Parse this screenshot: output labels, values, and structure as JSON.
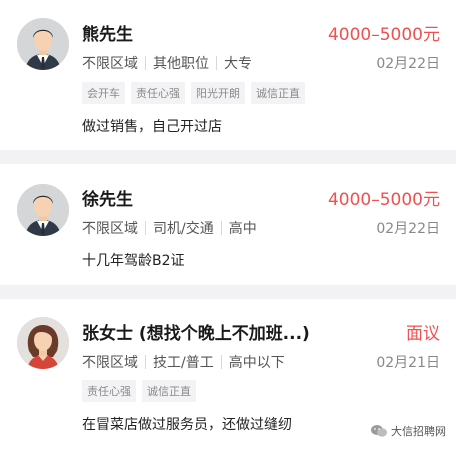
{
  "candidates": [
    {
      "name": "熊先生",
      "salary": "4000–5000元",
      "meta": [
        "不限区域",
        "其他职位",
        "大专"
      ],
      "date": "02月22日",
      "tags": [
        "会开车",
        "责任心强",
        "阳光开朗",
        "诚信正直"
      ],
      "description": "做过销售，自己开过店",
      "avatar": "male-avatar-icon"
    },
    {
      "name": "徐先生",
      "salary": "4000–5000元",
      "meta": [
        "不限区域",
        "司机/交通",
        "高中"
      ],
      "date": "02月22日",
      "tags": [],
      "description": "十几年驾龄B2证",
      "avatar": "male-avatar-icon"
    },
    {
      "name": "张女士 (想找个晚上不加班...)",
      "salary": "面议",
      "meta": [
        "不限区域",
        "技工/普工",
        "高中以下"
      ],
      "date": "02月21日",
      "tags": [
        "责任心强",
        "诚信正直"
      ],
      "description": "在冒菜店做过服务员，还做过缝纫",
      "avatar": "female-avatar-icon"
    }
  ],
  "watermark": {
    "text": "大信招聘网",
    "icon": "wechat-icon"
  },
  "colors": {
    "accent": "#f0504f",
    "background": "#f2f2f4"
  }
}
